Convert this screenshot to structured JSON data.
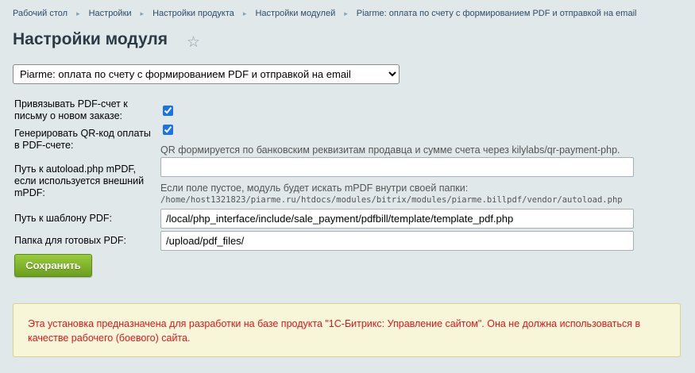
{
  "breadcrumb": [
    "Рабочий стол",
    "Настройки",
    "Настройки продукта",
    "Настройки модулей",
    "Piarme: оплата по счету с формированием PDF и отправкой на email"
  ],
  "page": {
    "title": "Настройки модуля"
  },
  "module_select": {
    "value": "Piarme: оплата по счету с формированием PDF и отправкой на email",
    "options": [
      "Piarme: оплата по счету с формированием PDF и отправкой на email"
    ]
  },
  "form": {
    "attach_pdf": {
      "label": "Привязывать PDF-счет к письму о новом заказе:",
      "checked": true
    },
    "qr_code": {
      "label": "Генерировать QR-код оплаты в PDF-счете:",
      "checked": true,
      "hint": "QR формируется по банковским реквизитам продавца и сумме счета через kilylabs/qr-payment-php."
    },
    "autoload": {
      "label": "Путь к autoload.php mPDF, если используется внешний mPDF:",
      "value": "",
      "hint": "Если поле пустое, модуль будет искать mPDF внутри своей папки:",
      "path": "/home/host1321823/piarme.ru/htdocs/modules/bitrix/modules/piarme.billpdf/vendor/autoload.php"
    },
    "template": {
      "label": "Путь к шаблону PDF:",
      "value": "/local/php_interface/include/sale_payment/pdfbill/template/template_pdf.php"
    },
    "folder": {
      "label": "Папка для готовых PDF:",
      "value": "/upload/pdf_files/"
    },
    "save_label": "Сохранить"
  },
  "warning": {
    "text": "Эта установка предназначена для разработки на базе продукта \"1С-Битрикс: Управление сайтом\". Она не должна использоваться в качестве рабочего (боевого) сайта."
  },
  "colors": {
    "accent": "#6b9f1c",
    "warning_text": "#e4151c",
    "warning_bg": "#f8f6d8",
    "background": "#e0e8ea"
  }
}
